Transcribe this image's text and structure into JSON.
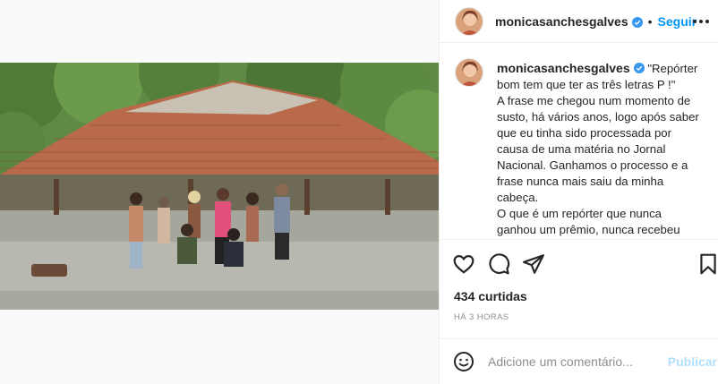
{
  "post": {
    "username": "monicasanchesgalves",
    "follow_label": "Seguir",
    "separator": "•",
    "caption_lines": [
      "\"Repórter",
      "bom tem que ter as três letras P !\"",
      "A frase me chegou num momento de",
      "susto, há vários anos, logo após saber",
      "que eu tinha sido processada por",
      "causa de uma matéria no Jornal",
      "Nacional. Ganhamos o processo e a",
      "frase nunca mais saiu da minha",
      "cabeça.",
      "O que é um repórter que nunca",
      "ganhou um prêmio, nunca recebeu"
    ],
    "likes_text": "434 curtidas",
    "time_text": "HÁ 3 HORAS"
  },
  "comment": {
    "placeholder": "Adicione um comentário...",
    "publish_label": "Publicar"
  },
  "icons": {
    "verified": "verified-badge-icon",
    "more": "more-options-icon",
    "like": "heart-icon",
    "comment": "comment-bubble-icon",
    "share": "paper-plane-icon",
    "save": "bookmark-icon",
    "emoji": "emoji-smiley-icon"
  },
  "colors": {
    "link_blue": "#0095f6",
    "publish_disabled": "#b2dffc",
    "muted": "#8e8e8e",
    "text": "#262626",
    "verified_blue": "#3897f0"
  }
}
